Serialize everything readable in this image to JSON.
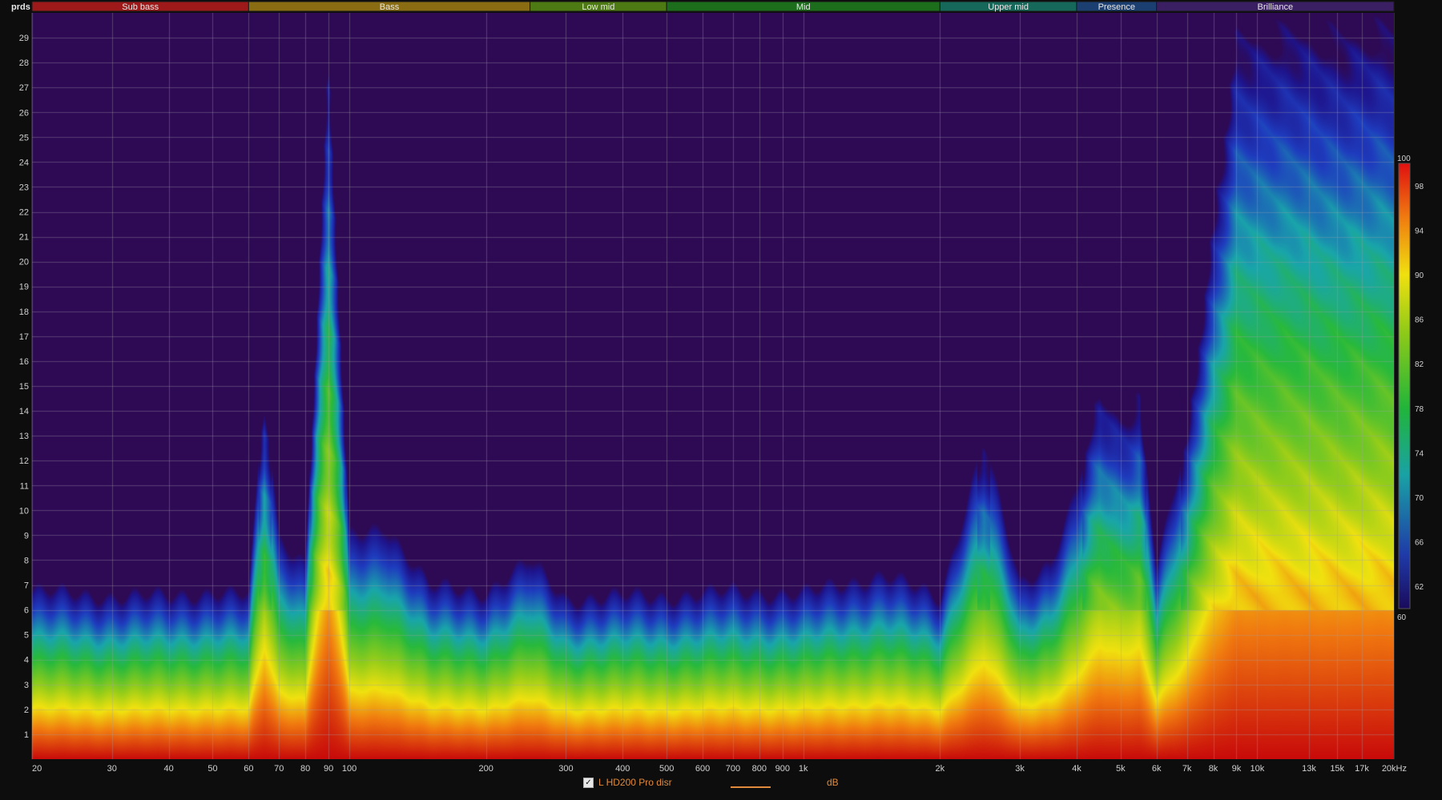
{
  "chart_data": {
    "type": "heatmap",
    "title": "",
    "y_unit_label": "prds",
    "xlabel": "",
    "ylabel": "",
    "x_scale": "log",
    "xlim": [
      20,
      20000
    ],
    "ylim": [
      0,
      30
    ],
    "x_ticks": [
      {
        "v": 20,
        "label": "20"
      },
      {
        "v": 30,
        "label": "30"
      },
      {
        "v": 40,
        "label": "40"
      },
      {
        "v": 50,
        "label": "50"
      },
      {
        "v": 60,
        "label": "60"
      },
      {
        "v": 70,
        "label": "70"
      },
      {
        "v": 80,
        "label": "80"
      },
      {
        "v": 90,
        "label": "90"
      },
      {
        "v": 100,
        "label": "100"
      },
      {
        "v": 200,
        "label": "200"
      },
      {
        "v": 300,
        "label": "300"
      },
      {
        "v": 400,
        "label": "400"
      },
      {
        "v": 500,
        "label": "500"
      },
      {
        "v": 600,
        "label": "600"
      },
      {
        "v": 700,
        "label": "700"
      },
      {
        "v": 800,
        "label": "800"
      },
      {
        "v": 900,
        "label": "900"
      },
      {
        "v": 1000,
        "label": "1k"
      },
      {
        "v": 2000,
        "label": "2k"
      },
      {
        "v": 3000,
        "label": "3k"
      },
      {
        "v": 4000,
        "label": "4k"
      },
      {
        "v": 5000,
        "label": "5k"
      },
      {
        "v": 6000,
        "label": "6k"
      },
      {
        "v": 7000,
        "label": "7k"
      },
      {
        "v": 8000,
        "label": "8k"
      },
      {
        "v": 9000,
        "label": "9k"
      },
      {
        "v": 10000,
        "label": "10k"
      },
      {
        "v": 13000,
        "label": "13k"
      },
      {
        "v": 15000,
        "label": "15k"
      },
      {
        "v": 17000,
        "label": "17k"
      },
      {
        "v": 20000,
        "label": "20kHz"
      }
    ],
    "y_ticks": [
      1,
      2,
      3,
      4,
      5,
      6,
      7,
      8,
      9,
      10,
      11,
      12,
      13,
      14,
      15,
      16,
      17,
      18,
      19,
      20,
      21,
      22,
      23,
      24,
      25,
      26,
      27,
      28,
      29
    ],
    "bands": [
      {
        "name": "Sub bass",
        "from": 20,
        "to": 60,
        "color": "#9e1a1a"
      },
      {
        "name": "Bass",
        "from": 60,
        "to": 250,
        "color": "#8a6d12"
      },
      {
        "name": "Low mid",
        "from": 250,
        "to": 500,
        "color": "#4e7a14"
      },
      {
        "name": "Mid",
        "from": 500,
        "to": 2000,
        "color": "#1c6e1c"
      },
      {
        "name": "Upper mid",
        "from": 2000,
        "to": 4000,
        "color": "#16695a"
      },
      {
        "name": "Presence",
        "from": 4000,
        "to": 6000,
        "color": "#1c3f72"
      },
      {
        "name": "Brilliance",
        "from": 6000,
        "to": 20000,
        "color": "#3b1f63"
      }
    ],
    "colorbar": {
      "min": 60,
      "max": 100,
      "ticks": [
        100,
        98,
        94,
        90,
        86,
        82,
        78,
        74,
        70,
        66,
        62,
        60
      ]
    },
    "decay_profile": [
      {
        "f": 20,
        "periods_at_60dB": 6.8
      },
      {
        "f": 30,
        "periods_at_60dB": 6.6
      },
      {
        "f": 40,
        "periods_at_60dB": 6.6
      },
      {
        "f": 50,
        "periods_at_60dB": 6.8
      },
      {
        "f": 60,
        "periods_at_60dB": 6.6
      },
      {
        "f": 65,
        "periods_at_60dB": 15
      },
      {
        "f": 70,
        "periods_at_60dB": 9
      },
      {
        "f": 80,
        "periods_at_60dB": 8
      },
      {
        "f": 90,
        "periods_at_60dB": 29
      },
      {
        "f": 100,
        "periods_at_60dB": 9
      },
      {
        "f": 120,
        "periods_at_60dB": 9.5
      },
      {
        "f": 150,
        "periods_at_60dB": 7
      },
      {
        "f": 200,
        "periods_at_60dB": 6.8
      },
      {
        "f": 250,
        "periods_at_60dB": 8
      },
      {
        "f": 300,
        "periods_at_60dB": 6.5
      },
      {
        "f": 400,
        "periods_at_60dB": 6.6
      },
      {
        "f": 500,
        "periods_at_60dB": 6.6
      },
      {
        "f": 700,
        "periods_at_60dB": 6.8
      },
      {
        "f": 1000,
        "periods_at_60dB": 6.7
      },
      {
        "f": 1500,
        "periods_at_60dB": 7.5
      },
      {
        "f": 2000,
        "periods_at_60dB": 6.5
      },
      {
        "f": 2500,
        "periods_at_60dB": 13
      },
      {
        "f": 3000,
        "periods_at_60dB": 7
      },
      {
        "f": 3500,
        "periods_at_60dB": 8
      },
      {
        "f": 4000,
        "periods_at_60dB": 11
      },
      {
        "f": 4500,
        "periods_at_60dB": 15
      },
      {
        "f": 5000,
        "periods_at_60dB": 14
      },
      {
        "f": 5500,
        "periods_at_60dB": 15
      },
      {
        "f": 6000,
        "periods_at_60dB": 8
      },
      {
        "f": 7000,
        "periods_at_60dB": 13
      },
      {
        "f": 8000,
        "periods_at_60dB": 22
      },
      {
        "f": 9000,
        "periods_at_60dB": 30
      },
      {
        "f": 10000,
        "periods_at_60dB": 30
      },
      {
        "f": 13000,
        "periods_at_60dB": 30
      },
      {
        "f": 15000,
        "periods_at_60dB": 30
      },
      {
        "f": 20000,
        "periods_at_60dB": 30
      }
    ],
    "legend": [
      {
        "name": "L HD200 Pro disr",
        "checked": true
      }
    ],
    "legend_unit": "dB"
  }
}
